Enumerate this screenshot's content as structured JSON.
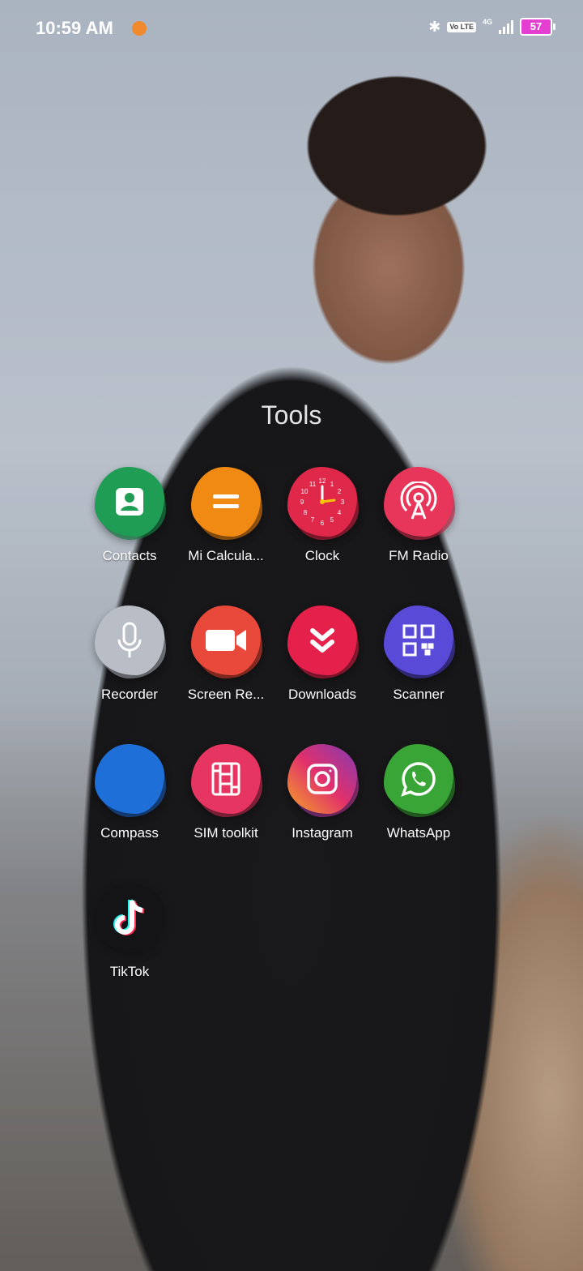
{
  "status_bar": {
    "time": "10:59 AM",
    "network_type": "4G",
    "volte_label": "Vo LTE",
    "battery_level": "57",
    "battery_color": "#e53fd1"
  },
  "folder": {
    "title": "Tools",
    "apps": [
      {
        "label": "Contacts",
        "icon": "contacts-icon",
        "color": "#1f9d55"
      },
      {
        "label": "Mi Calcula...",
        "icon": "calculator-icon",
        "color": "#f08a12"
      },
      {
        "label": "Clock",
        "icon": "clock-icon",
        "color": "#e0284a"
      },
      {
        "label": "FM Radio",
        "icon": "radio-icon",
        "color": "#e8365a"
      },
      {
        "label": "Recorder",
        "icon": "microphone-icon",
        "color": "#b9bec6"
      },
      {
        "label": "Screen Re...",
        "icon": "video-camera-icon",
        "color": "#e8493a"
      },
      {
        "label": "Downloads",
        "icon": "download-icon",
        "color": "#e5204a"
      },
      {
        "label": "Scanner",
        "icon": "scanner-icon",
        "color": "#5a4ad8"
      },
      {
        "label": "Compass",
        "icon": "compass-icon",
        "color": "#1e6fd8"
      },
      {
        "label": "SIM toolkit",
        "icon": "sim-card-icon",
        "color": "#e53560"
      },
      {
        "label": "Instagram",
        "icon": "instagram-icon",
        "color": "#c13584"
      },
      {
        "label": "WhatsApp",
        "icon": "whatsapp-icon",
        "color": "#3aa537"
      },
      {
        "label": "TikTok",
        "icon": "tiktok-icon",
        "color": "#111111"
      }
    ]
  }
}
